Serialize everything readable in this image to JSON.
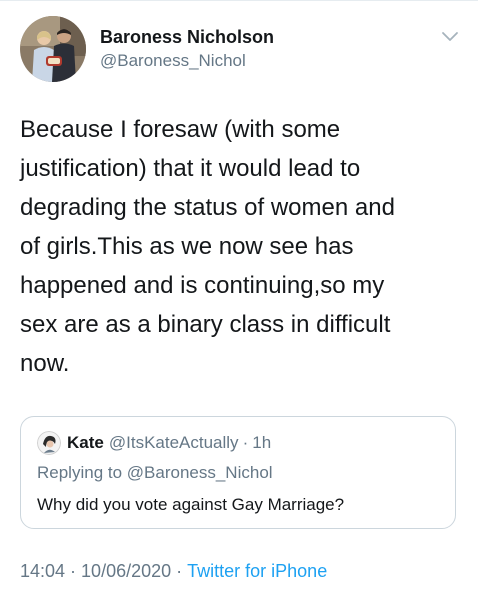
{
  "author": {
    "display_name": "Baroness Nicholson",
    "handle": "@Baroness_Nichol"
  },
  "tweet": {
    "text": "Because I foresaw (with some\njustification) that it would lead to\ndegrading the status of women and\nof girls.This as we now see has\nhappened and is continuing,so my\nsex are as a binary class in difficult\nnow."
  },
  "quoted_tweet": {
    "display_name": "Kate",
    "handle": "@ItsKateActually",
    "separator": "·",
    "time": "1h",
    "replying_prefix": "Replying to ",
    "replying_to": "@Baroness_Nichol",
    "text": "Why did you vote against Gay Marriage?"
  },
  "meta": {
    "time": "14:04",
    "date": "10/06/2020",
    "separator": "·",
    "source": "Twitter for iPhone"
  },
  "icons": {
    "menu": "chevron-down-icon"
  },
  "colors": {
    "link": "#1da1f2",
    "secondary_text": "#657786",
    "primary_text": "#14171a",
    "border": "#ccd6dd"
  }
}
